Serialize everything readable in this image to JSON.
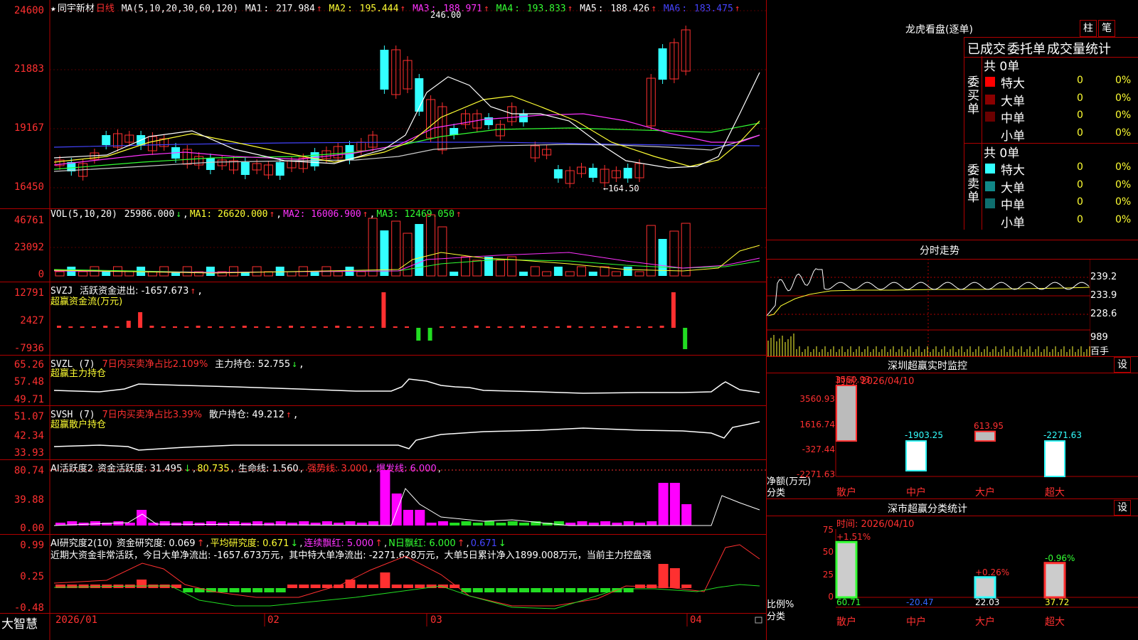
{
  "colors": {
    "up": "#ff3030",
    "down": "#33ffff",
    "bg": "#000000",
    "grid": "#8b0000",
    "ma1": "#ffffff",
    "ma2": "#ffff33",
    "ma3": "#ff33ff",
    "ma4": "#33ff33",
    "ma5": "#cccccc",
    "ma6": "#4444ff",
    "buy_vol": "#ff00ff",
    "green": "#22dd22"
  },
  "main_chart": {
    "stock_name": "同宇新材",
    "period": "日线",
    "star": "★",
    "ma_label": "MA(5,10,20,30,60,120)",
    "ma": [
      {
        "name": "MA1",
        "value": "217.984",
        "arrow": "↑"
      },
      {
        "name": "MA2",
        "value": "195.444",
        "arrow": "↑"
      },
      {
        "name": "MA3",
        "value": "188.971",
        "arrow": "↑"
      },
      {
        "name": "MA4",
        "value": "193.833",
        "arrow": "↑"
      },
      {
        "name": "MA5",
        "value": "188.426",
        "arrow": "↑"
      },
      {
        "name": "MA6",
        "value": "183.475",
        "arrow": "↑"
      }
    ],
    "y_labels": [
      "24600",
      "21883",
      "19167",
      "16450"
    ],
    "high_marker": "246.00",
    "low_marker": "←164.50",
    "x_labels": [
      "2026/01",
      "02",
      "03",
      "04"
    ],
    "brand": "大智慧"
  },
  "vol": {
    "label": "VOL(5,10,20)",
    "value": "25986.000",
    "arrow": "↓",
    "ma1": "MA1: 26620.000",
    "ma2": "MA2: 16006.900",
    "ma3": "MA3: 12469.050",
    "y_labels": [
      "46761",
      "23092",
      "0"
    ]
  },
  "svzj": {
    "label": "SVZJ",
    "text": "活跃资金进出: -1657.673",
    "arrow": "↑",
    "sub": "超赢资金流(万元)",
    "y_labels": [
      "12791",
      "2427",
      "-7936"
    ]
  },
  "svzl": {
    "label": "SVZL (7)",
    "red_text": "7日内买卖净占比2.109%",
    "text": "主力持仓: 52.755",
    "arrow": "↓",
    "sub": "超赢主力持仓",
    "y_labels": [
      "65.26",
      "57.48",
      "49.71"
    ]
  },
  "svsh": {
    "label": "SVSH (7)",
    "red_text": "7日内买卖净占比3.39%",
    "text": "散户持仓: 49.212",
    "arrow": "↑",
    "sub": "超赢散户持仓",
    "y_labels": [
      "51.07",
      "42.34",
      "33.93"
    ]
  },
  "ai1": {
    "label": "AI活跃度2",
    "t1": "资金活跃度: 31.495",
    "a1": "↓",
    "t2": "80.735",
    "t3": "生命线: 1.560",
    "t4": "强势线: 3.000",
    "t5": "爆发线: 6.000",
    "y_labels": [
      "80.74",
      "39.88",
      "0.00"
    ]
  },
  "ai2": {
    "label": "AI研究度2(10)",
    "t1": "资金研究度: 0.069",
    "a1": "↑",
    "t2": "平均研究度: 0.671",
    "a2": "↓",
    "t3": "连续飘红: 5.000",
    "a3": "↑",
    "t4": "N日飘红: 6.000",
    "a4": "↑",
    "t5": "0.671",
    "a5": "↓",
    "desc": "近期大资金非常活跃，今日大单净流出: -1657.673万元，其中特大单净流出: -2271.628万元，大单5日累计净入1899.008万元，当前主力控盘强",
    "y_labels": [
      "0.99",
      "0.25",
      "-0.48"
    ]
  },
  "lhb": {
    "title": "龙虎看盘(逐单)",
    "btn1": "柱",
    "btn2": "笔",
    "tabs": [
      "已成交",
      "委托单",
      "成交量统计"
    ],
    "buy": {
      "side": "委买单",
      "total": "共 0单",
      "rows": [
        {
          "label": "特大",
          "n": "0",
          "p": "0%",
          "color": "#ff0000"
        },
        {
          "label": "大单",
          "n": "0",
          "p": "0%",
          "color": "#8b0000"
        },
        {
          "label": "中单",
          "n": "0",
          "p": "0%",
          "color": "#6b0000"
        },
        {
          "label": "小单",
          "n": "0",
          "p": "0%",
          "color": "#000000"
        }
      ]
    },
    "sell": {
      "side": "委卖单",
      "total": "共 0单",
      "rows": [
        {
          "label": "特大",
          "n": "0",
          "p": "0%",
          "color": "#33ffff"
        },
        {
          "label": "大单",
          "n": "0",
          "p": "0%",
          "color": "#118888"
        },
        {
          "label": "中单",
          "n": "0",
          "p": "0%",
          "color": "#0e6e6e"
        },
        {
          "label": "小单",
          "n": "0",
          "p": "0%",
          "color": "#000000"
        }
      ]
    }
  },
  "fenshi": {
    "title": "分时走势",
    "y_labels": [
      "239.2",
      "233.9",
      "228.6"
    ],
    "vol_label": "989",
    "unit": "百手"
  },
  "sz_monitor": {
    "title": "深圳超赢实时监控",
    "btn": "设",
    "time": "时间: 2026/04/10",
    "y_labels": [
      "3560.93",
      "1616.74",
      "-327.44",
      "-2271.63"
    ],
    "y_title": "净额(万元)",
    "x_title": "分类",
    "chart_data": {
      "type": "bar",
      "categories": [
        "散户",
        "中户",
        "大户",
        "超大"
      ],
      "values": [
        3560.93,
        -1903.25,
        613.95,
        -2271.63
      ],
      "value_labels": [
        "3560.93",
        "-1903.25",
        "613.95",
        "-2271.63"
      ],
      "ylim": [
        -2271.63,
        3560.93
      ],
      "ylabel": "净额(万元)",
      "xlabel": "分类"
    }
  },
  "sz_class": {
    "title": "深市超赢分类统计",
    "btn": "设",
    "time": "时间: 2026/04/10",
    "y_labels": [
      "75",
      "50",
      "25",
      "0"
    ],
    "y_title": "比例%",
    "x_title": "分类",
    "chart_data": {
      "type": "bar",
      "categories": [
        "散户",
        "中户",
        "大户",
        "超大"
      ],
      "values": [
        60.71,
        20.47,
        22.03,
        37.72
      ],
      "bottom_labels": [
        "60.71",
        "-20.47",
        "22.03",
        "37.72"
      ],
      "top_labels": [
        "+1.51%",
        "",
        "+0.26%",
        "-0.96%"
      ],
      "ylim": [
        0,
        75
      ],
      "ylabel": "比例%",
      "xlabel": "分类"
    }
  }
}
